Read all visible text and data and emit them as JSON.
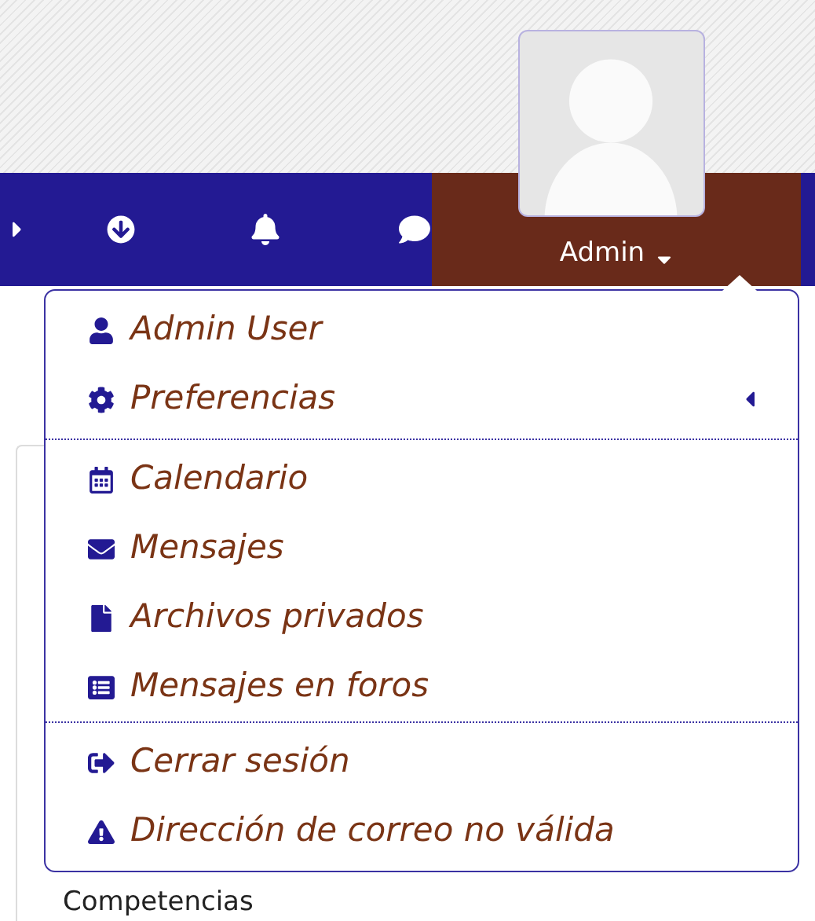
{
  "navbar": {
    "icons": [
      {
        "kind": "caret"
      },
      {
        "kind": "download"
      },
      {
        "kind": "bell"
      },
      {
        "kind": "chat"
      }
    ],
    "user_label": "Admin"
  },
  "user_menu": {
    "groups": [
      [
        {
          "label": "Admin User",
          "kind": "user",
          "has_submenu": false
        },
        {
          "label": "Preferencias",
          "kind": "gear",
          "has_submenu": true
        }
      ],
      [
        {
          "label": "Calendario",
          "kind": "calendar",
          "has_submenu": false
        },
        {
          "label": "Mensajes",
          "kind": "envelope",
          "has_submenu": false
        },
        {
          "label": "Archivos privados",
          "kind": "file",
          "has_submenu": false
        },
        {
          "label": "Mensajes en foros",
          "kind": "list",
          "has_submenu": false
        }
      ],
      [
        {
          "label": "Cerrar sesión",
          "kind": "logout",
          "has_submenu": false
        },
        {
          "label": "Dirección de correo no válida",
          "kind": "warning",
          "has_submenu": false
        }
      ]
    ]
  },
  "background_item": "Competencias"
}
